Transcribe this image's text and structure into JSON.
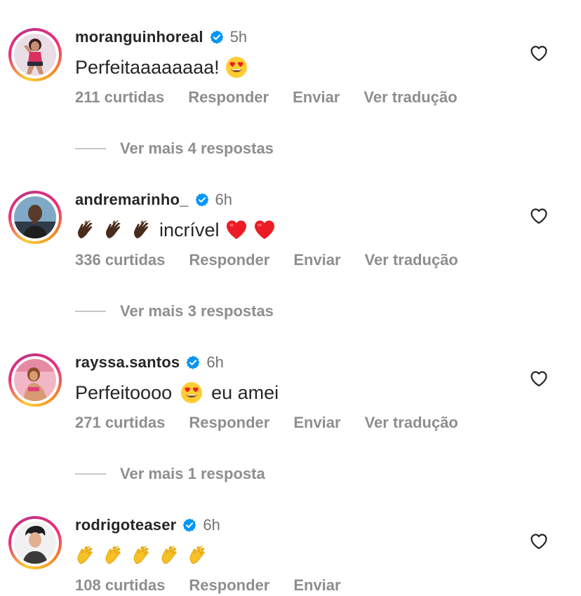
{
  "comments": [
    {
      "username": "moranguinhoreal",
      "time": "5h",
      "text": "Perfeitaaaaaaaa!",
      "text_emoji": "heart-eyes",
      "likes": "211 curtidas",
      "reply": "Responder",
      "send": "Enviar",
      "translate": "Ver tradução",
      "more_replies": "Ver mais 4 respostas"
    },
    {
      "username": "andremarinho_",
      "time": "6h",
      "text": "incrível",
      "text_emoji": "clapping-hands and red-hearts",
      "likes": "336 curtidas",
      "reply": "Responder",
      "send": "Enviar",
      "translate": "Ver tradução",
      "more_replies": "Ver mais 3 respostas"
    },
    {
      "username": "rayssa.santos",
      "time": "6h",
      "text_before": "Perfeitoooo",
      "text_after": "eu amei",
      "text_emoji": "heart-eyes",
      "likes": "271 curtidas",
      "reply": "Responder",
      "send": "Enviar",
      "translate": "Ver tradução",
      "more_replies": "Ver mais 1 resposta"
    },
    {
      "username": "rodrigoteaser",
      "time": "6h",
      "text_emoji": "five clapping-hands",
      "likes": "108 curtidas",
      "reply": "Responder",
      "send": "Enviar"
    }
  ],
  "colors": {
    "text": "#262626",
    "muted": "#8e8e8e",
    "verified": "#0095f6",
    "heart_red": "#ed1c24",
    "emoji_yellow": "#ffcc33"
  }
}
